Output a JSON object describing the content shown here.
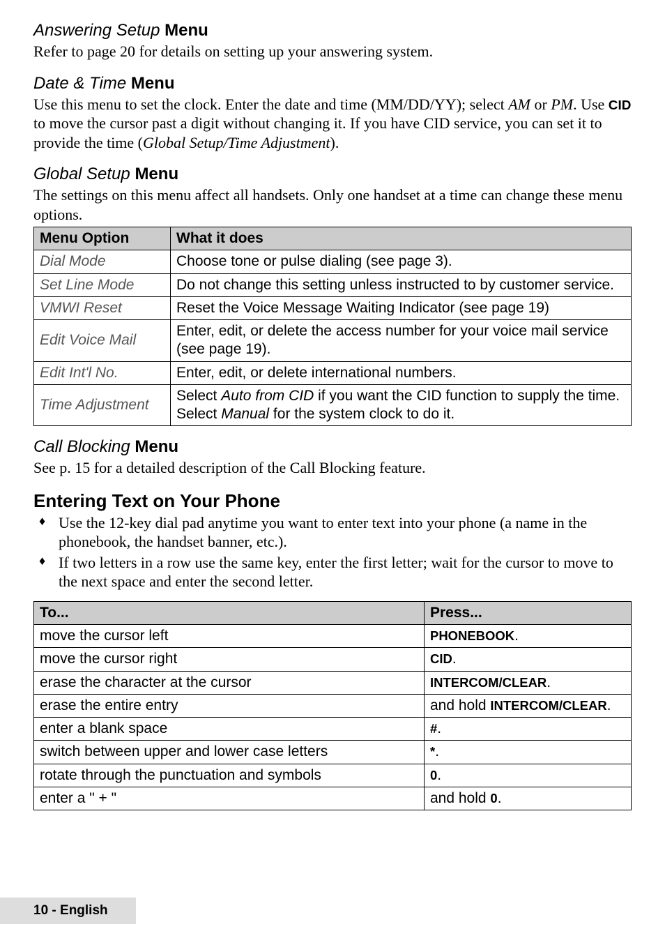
{
  "sections": {
    "answering": {
      "heading_italic": "Answering Setup ",
      "heading_bold": "Menu",
      "body": "Refer to page 20 for details on setting up your answering system."
    },
    "datetime": {
      "heading_italic": "Date & Time ",
      "heading_bold": "Menu",
      "body_parts": {
        "p1": "Use this menu to set the clock. Enter the date and time (MM/DD/YY); select ",
        "am": "AM",
        "p2": " or ",
        "pm": "PM",
        "p3": ". Use ",
        "cid": "CID",
        "p4": " to move the cursor past a digit without changing it. If you have CID service, you can set it to provide the time (",
        "gst": "Global Setup/Time Adjustment",
        "p5": ")."
      }
    },
    "global": {
      "heading_italic": "Global Setup ",
      "heading_bold": "Menu",
      "body": "The settings on this menu affect all handsets. Only one handset at a time can change these menu options.",
      "table": {
        "headers": {
          "col1": "Menu Option",
          "col2": "What it does"
        },
        "rows": [
          {
            "opt": "Dial Mode",
            "desc": "Choose tone or pulse dialing (see page 3)."
          },
          {
            "opt": "Set Line Mode",
            "desc": "Do not change this setting unless instructed to by customer service."
          },
          {
            "opt": "VMWI Reset",
            "desc": "Reset the Voice Message Waiting Indicator (see page 19)"
          },
          {
            "opt": "Edit Voice Mail",
            "desc": "Enter, edit, or delete the access number for your voice mail service (see page 19)."
          },
          {
            "opt": "Edit Int'l No.",
            "desc": "Enter, edit, or delete international numbers."
          }
        ],
        "time_adj": {
          "opt": "Time Adjustment",
          "p1": "Select ",
          "i1": "Auto from CID",
          "p2": " if you want the CID function to supply the time. Select ",
          "i2": "Manual",
          "p3": " for the system clock to do it."
        }
      }
    },
    "callblocking": {
      "heading_italic": "Call Blocking ",
      "heading_bold": "Menu",
      "body": "See p. 15 for a detailed description of the Call Blocking feature."
    },
    "entering": {
      "heading": "Entering Text on Your Phone",
      "bullets": [
        "Use the 12-key dial pad anytime you want to enter text into your phone (a name in the phonebook, the handset banner, etc.).",
        "If two letters in a row use the same key, enter the first letter; wait for the cursor to move to the next space and enter the second letter."
      ],
      "table": {
        "headers": {
          "col1": "To...",
          "col2": "Press..."
        },
        "rows": [
          {
            "to": "move the cursor left",
            "pre": "",
            "key": "PHONEBOOK",
            "post": "."
          },
          {
            "to": "move the cursor right",
            "pre": "",
            "key": "CID",
            "post": "."
          },
          {
            "to": "erase the character at the cursor",
            "pre": "",
            "key": "INTERCOM/CLEAR",
            "post": "."
          },
          {
            "to": "erase the entire entry",
            "pre": "and hold ",
            "key": "INTERCOM/CLEAR",
            "post": "."
          },
          {
            "to": "enter a blank space",
            "pre": "",
            "key": "#",
            "post": "."
          },
          {
            "to": "switch between upper and lower case letters",
            "pre": "",
            "key": "*",
            "post": "."
          },
          {
            "to": "rotate through the punctuation and symbols",
            "pre": "",
            "key": "0",
            "post": "."
          },
          {
            "to": "enter a \" + \"",
            "pre": "and hold ",
            "key": "0",
            "post": "."
          }
        ]
      }
    }
  },
  "footer": "10 - English"
}
